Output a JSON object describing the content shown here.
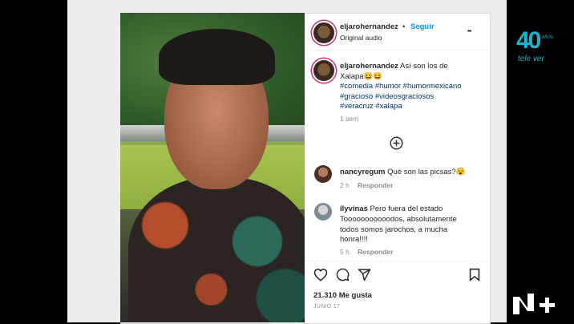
{
  "header": {
    "username": "eljarohernandez",
    "separator": "•",
    "follow_label": "Seguir",
    "subtitle": "Original audio",
    "more_glyph": "•••"
  },
  "caption": {
    "username": "eljarohernandez",
    "text_line1": "Así son los de",
    "text_line2": "Xalapa😆😆",
    "hashtags_line1": "#comedia #humor #humormexicano",
    "hashtags_line2": "#gracioso #videosgraciosos",
    "hashtags_line3": "#veracruz #xalapa",
    "time": "1 sem"
  },
  "load_more_icon": "plus-circle-icon",
  "comments": [
    {
      "username": "nancyregum",
      "text": "Qué son las picsas?😵",
      "time": "2 h",
      "reply": "Responder"
    },
    {
      "username": "ilyvinas",
      "line1": "Pero fuera del estado",
      "line2": "Tooooooooooodos, absolutamente",
      "line3": "todos somos jarochos, a mucha",
      "line4": "honra!!!!",
      "time": "5 h",
      "reply": "Responder"
    }
  ],
  "actions": {
    "likes": "21.310 Me gusta",
    "date": "JUNIO 17",
    "icons": [
      "heart-icon",
      "comment-icon",
      "share-icon",
      "bookmark-icon"
    ]
  },
  "overlay": {
    "logo_number": "40",
    "logo_small": "AÑOS",
    "logo_brand": "tele ver",
    "corner_logo": "N+"
  },
  "colors": {
    "link_blue": "#0095f6",
    "hashtag_blue": "#00376b",
    "brand_teal": "#1bb3c9"
  }
}
